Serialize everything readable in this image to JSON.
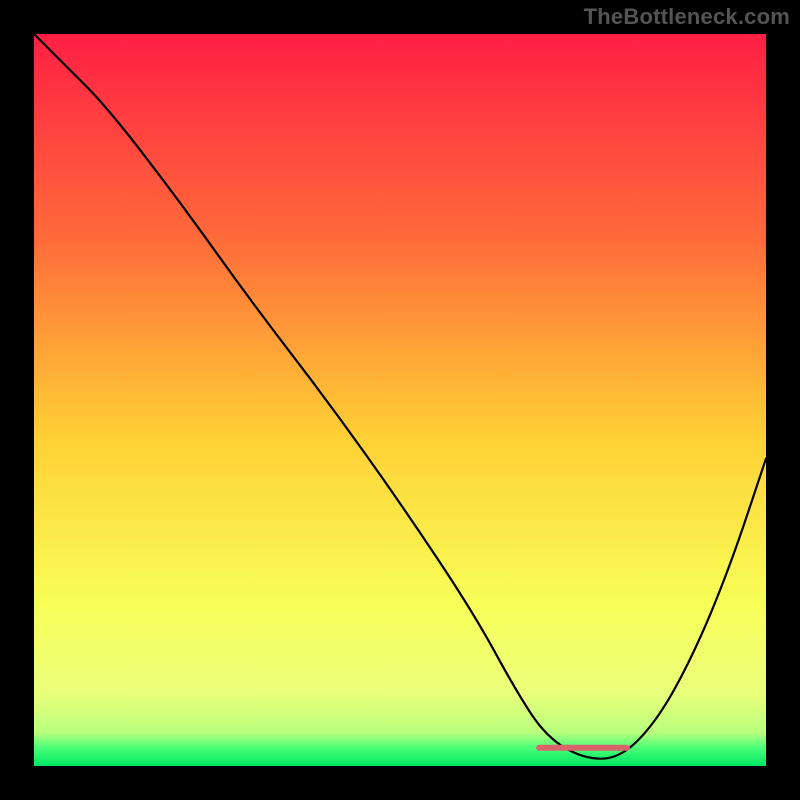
{
  "watermark": "TheBottleneck.com",
  "chart_data": {
    "type": "line",
    "title": "",
    "xlabel": "",
    "ylabel": "",
    "xlim": [
      0,
      100
    ],
    "ylim": [
      0,
      100
    ],
    "grid": false,
    "legend": false,
    "background_gradient": {
      "stops": [
        {
          "offset": 0.0,
          "color": "#ff1f44"
        },
        {
          "offset": 0.28,
          "color": "#ff6b3a"
        },
        {
          "offset": 0.55,
          "color": "#ffd035"
        },
        {
          "offset": 0.78,
          "color": "#f8ff59"
        },
        {
          "offset": 0.9,
          "color": "#eaff7a"
        },
        {
          "offset": 0.955,
          "color": "#b7ff7d"
        },
        {
          "offset": 0.975,
          "color": "#4bff77"
        },
        {
          "offset": 1.0,
          "color": "#00e765"
        }
      ]
    },
    "series": [
      {
        "name": "bottleneck-curve",
        "x": [
          0,
          4,
          10,
          20,
          30,
          40,
          50,
          60,
          66,
          70,
          75,
          80,
          85,
          90,
          95,
          100
        ],
        "y": [
          100,
          96,
          90,
          77,
          63,
          50,
          36,
          21,
          10,
          4,
          1,
          1,
          6,
          15,
          27,
          42
        ]
      }
    ],
    "annotations": [
      {
        "name": "optimal-range-marker",
        "type": "segment",
        "x0": 69,
        "y0": 2.5,
        "x1": 81,
        "y1": 2.5,
        "color": "#d9646b"
      }
    ]
  }
}
